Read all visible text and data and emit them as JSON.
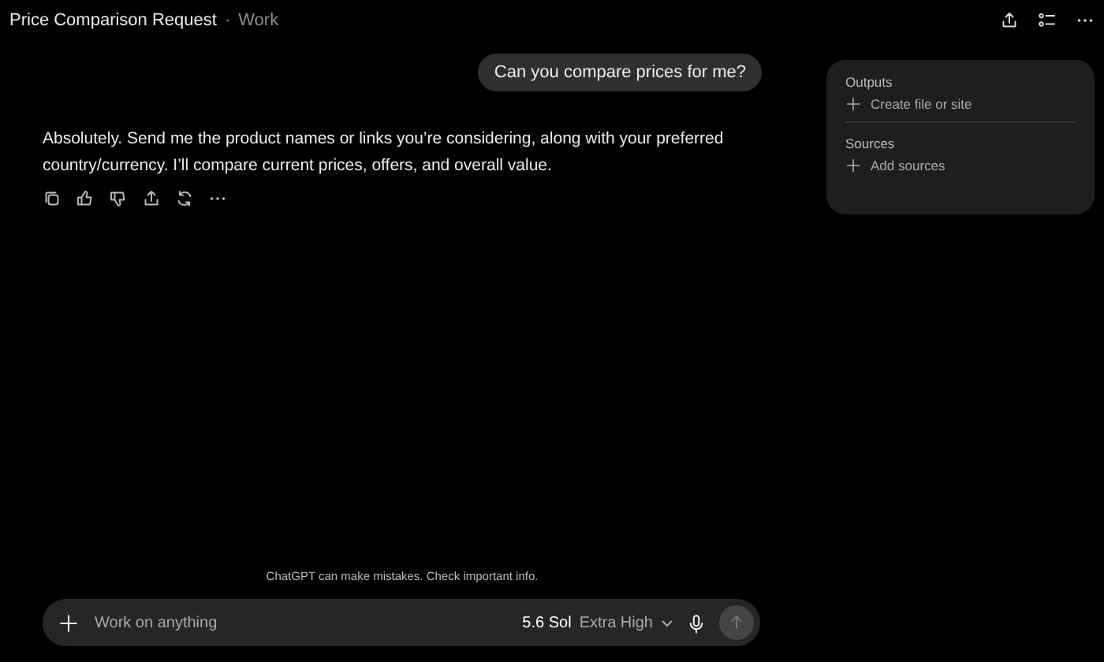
{
  "header": {
    "title": "Price Comparison Request",
    "separator": "·",
    "project": "Work"
  },
  "messages": [
    {
      "kind": "user",
      "text": "Can you compare prices for me?"
    },
    {
      "kind": "assistant",
      "text": "Absolutely. Send me the product names or links you’re considering, along with your preferred country/currency. I’ll compare current prices, offers, and overall value."
    }
  ],
  "side_panel": {
    "sections": [
      {
        "heading": "Outputs",
        "action": "Create file or site"
      },
      {
        "heading": "Sources",
        "action": "Add sources"
      }
    ]
  },
  "disclaimer": "ChatGPT can make mistakes. Check important info.",
  "composer": {
    "placeholder": "Work on anything",
    "model": "**5.6 Sol** Extra High"
  }
}
